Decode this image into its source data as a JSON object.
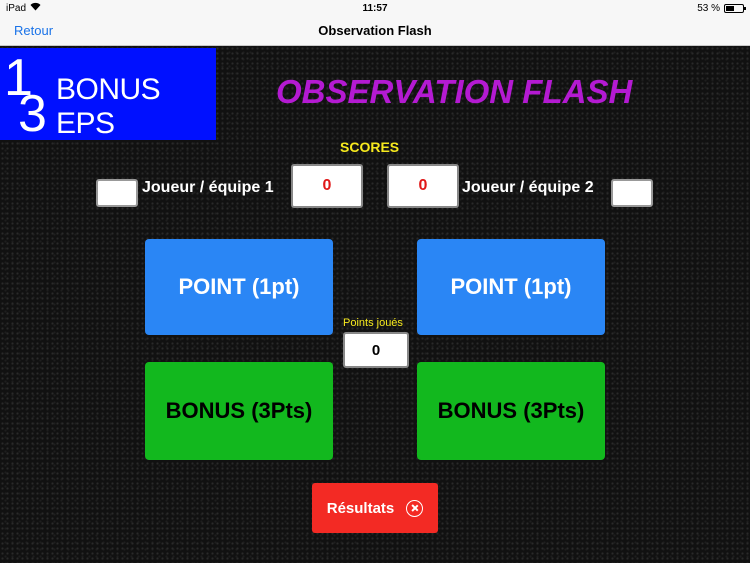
{
  "status_bar": {
    "device": "iPad",
    "time": "11:57",
    "battery": "53 %",
    "battery_level": 0.53
  },
  "nav": {
    "back_label": "Retour",
    "title": "Observation Flash"
  },
  "logo": {
    "digit_top": "1",
    "digit_bottom": "3",
    "text": "BONUS EPS"
  },
  "header": {
    "title": "OBSERVATION FLASH"
  },
  "scores": {
    "label": "SCORES",
    "player1": {
      "label": "Joueur / équipe 1",
      "score": "0"
    },
    "player2": {
      "label": "Joueur / équipe 2",
      "score": "0"
    }
  },
  "buttons": {
    "point_left": "POINT (1pt)",
    "point_right": "POINT (1pt)",
    "bonus_left": "BONUS (3Pts)",
    "bonus_right": "BONUS (3Pts)",
    "results": "Résultats"
  },
  "points_played": {
    "label": "Points joués",
    "value": "0"
  },
  "colors": {
    "title": "#b41ad2",
    "scores_label": "#f7ea1e",
    "point_button": "#2a86f5",
    "bonus_button": "#12b81e",
    "results_button": "#f32a24",
    "logo_bg": "#0010ff"
  }
}
